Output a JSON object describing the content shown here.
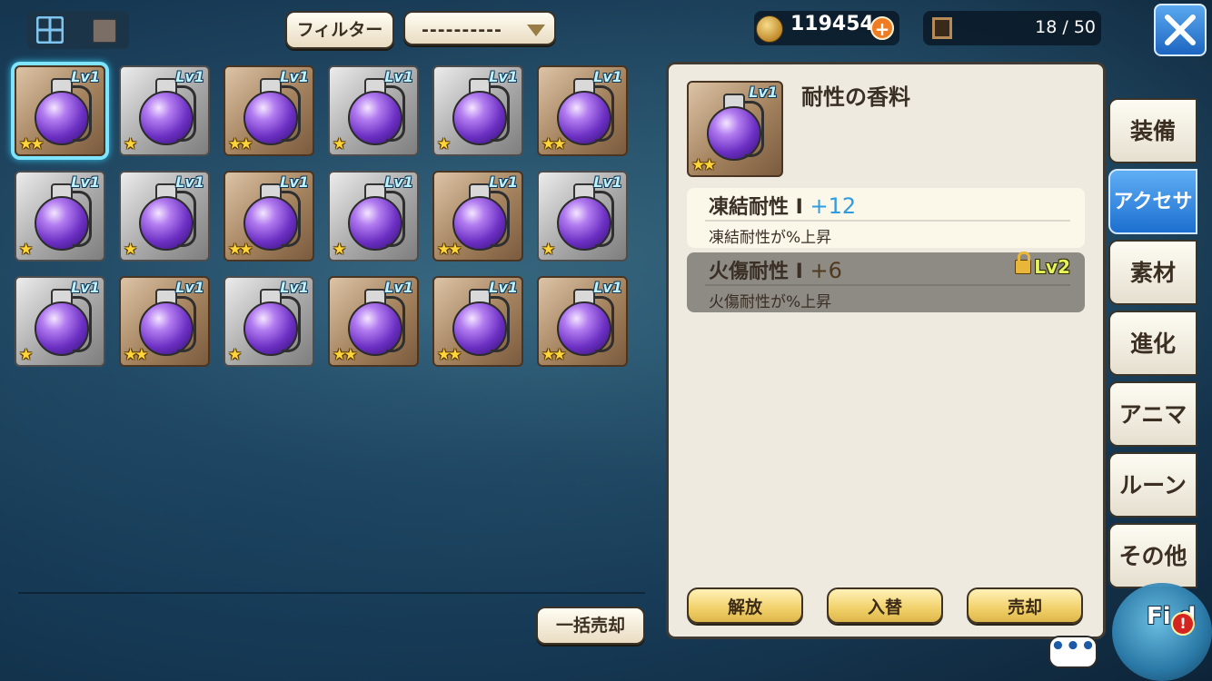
{
  "top_bar": {
    "filter_label": "フィルター",
    "filter_value": "----------",
    "gold": "119454",
    "gold_plus": "+",
    "capacity": "18 / 50"
  },
  "items": [
    {
      "lv": "Lv1",
      "stars": "★★",
      "frame": "bronze",
      "selected": true
    },
    {
      "lv": "Lv1",
      "stars": "★",
      "frame": "silver"
    },
    {
      "lv": "Lv1",
      "stars": "★★",
      "frame": "bronze"
    },
    {
      "lv": "Lv1",
      "stars": "★",
      "frame": "silver"
    },
    {
      "lv": "Lv1",
      "stars": "★",
      "frame": "silver"
    },
    {
      "lv": "Lv1",
      "stars": "★★",
      "frame": "bronze"
    },
    {
      "lv": "Lv1",
      "stars": "★",
      "frame": "silver"
    },
    {
      "lv": "Lv1",
      "stars": "★",
      "frame": "silver"
    },
    {
      "lv": "Lv1",
      "stars": "★★",
      "frame": "bronze"
    },
    {
      "lv": "Lv1",
      "stars": "★",
      "frame": "silver"
    },
    {
      "lv": "Lv1",
      "stars": "★★",
      "frame": "bronze"
    },
    {
      "lv": "Lv1",
      "stars": "★",
      "frame": "silver"
    },
    {
      "lv": "Lv1",
      "stars": "★",
      "frame": "silver"
    },
    {
      "lv": "Lv1",
      "stars": "★★",
      "frame": "bronze"
    },
    {
      "lv": "Lv1",
      "stars": "★",
      "frame": "silver"
    },
    {
      "lv": "Lv1",
      "stars": "★★",
      "frame": "bronze"
    },
    {
      "lv": "Lv1",
      "stars": "★★",
      "frame": "bronze"
    },
    {
      "lv": "Lv1",
      "stars": "★★",
      "frame": "bronze"
    }
  ],
  "bulk_sell": "一括売却",
  "detail": {
    "name": "耐性の香料",
    "lv": "Lv1",
    "stars": "★★",
    "stat1": {
      "name": "凍結耐性 I ",
      "value": "+12",
      "desc": "凍結耐性が%上昇"
    },
    "stat2": {
      "name": "火傷耐性 I ",
      "value": "+6",
      "desc": "火傷耐性が%上昇",
      "unlock": "Lv2"
    },
    "actions": {
      "release": "解放",
      "swap": "入替",
      "sell": "売却"
    }
  },
  "tabs": [
    "装備",
    "アクセサリ",
    "素材",
    "進化",
    "アニマ",
    "ルーン",
    "その他"
  ],
  "active_tab": 1,
  "chat": "•••",
  "field": {
    "label": "Fi  d",
    "alert": "!"
  },
  "colors": {
    "accent": "#1d6fd0",
    "stat_value": "#2d9ce0",
    "gold_plus": "#ef7b22"
  }
}
